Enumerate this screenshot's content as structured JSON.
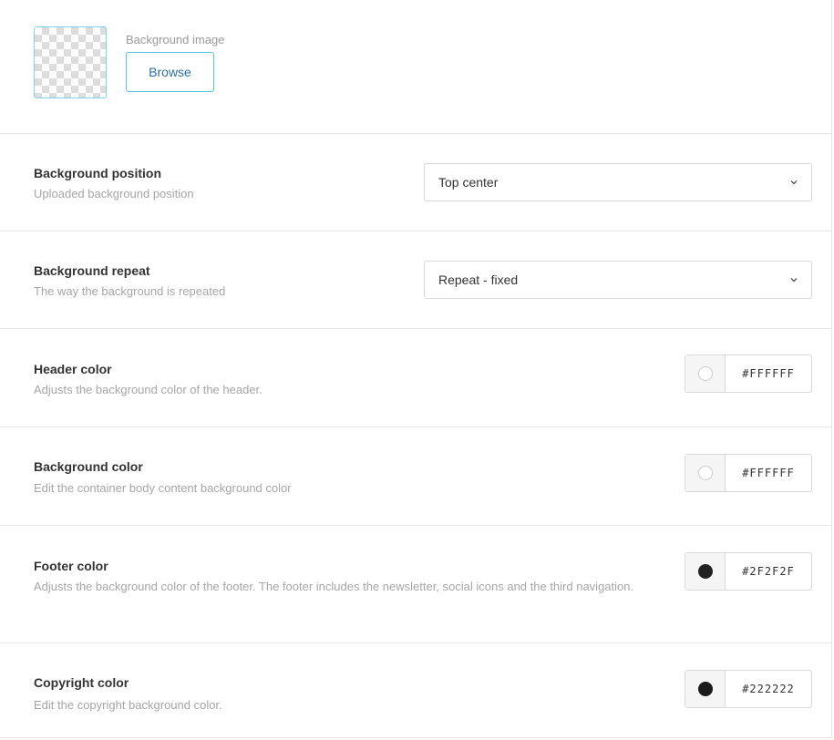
{
  "background_image": {
    "label": "Background image",
    "browse_label": "Browse"
  },
  "settings": [
    {
      "title": "Background position",
      "description": "Uploaded background position",
      "type": "select",
      "value": "Top center"
    },
    {
      "title": "Background repeat",
      "description": "The way the background is repeated",
      "type": "select",
      "value": "Repeat - fixed"
    },
    {
      "title": "Header color",
      "description": "Adjusts the background color of the header.",
      "type": "color",
      "hex": "#FFFFFF",
      "swatch": "#ffffff"
    },
    {
      "title": "Background color",
      "description": "Edit the container body content background color",
      "type": "color",
      "hex": "#FFFFFF",
      "swatch": "#ffffff"
    },
    {
      "title": "Footer color",
      "description": "Adjusts the background color of the footer. The footer includes the newsletter, social icons and the third navigation.",
      "type": "color",
      "hex": "#2F2F2F",
      "swatch": "#222222"
    },
    {
      "title": "Copyright color",
      "description": "Edit the copyright background color.",
      "type": "color",
      "hex": "#222222",
      "swatch": "#1a1a1a"
    }
  ],
  "colors": {
    "border": "#e6e6e6",
    "accent_border": "#5bc3dc",
    "link_text": "#2a6fa8"
  }
}
